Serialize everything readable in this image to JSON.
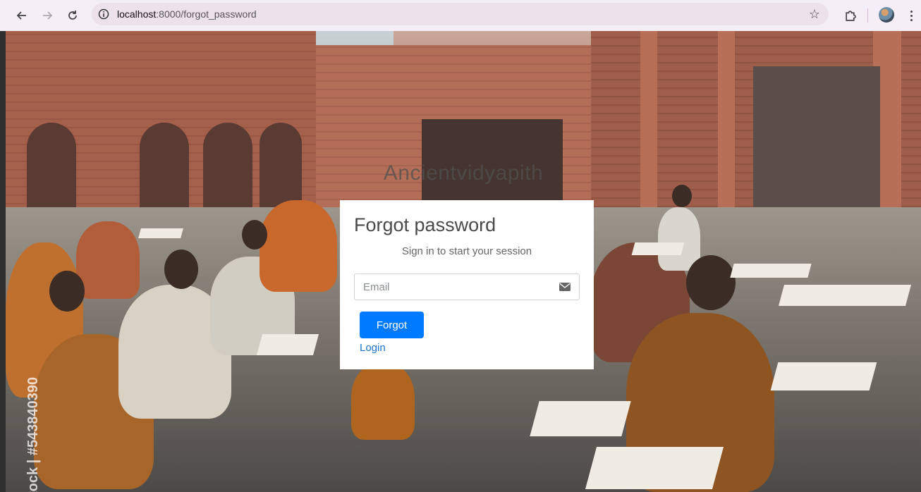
{
  "browser": {
    "url_host": "localhost",
    "url_rest": ":8000/forgot_password"
  },
  "page": {
    "brand": "Ancientvidyapith",
    "watermark": "tock | #543840390"
  },
  "card": {
    "title": "Forgot password",
    "message": "Sign in to start your session",
    "email_placeholder": "Email",
    "email_value": "",
    "submit_label": "Forgot",
    "login_link": "Login",
    "accent_color": "#007bff"
  },
  "icons": {
    "back": "arrow-left-icon",
    "forward": "arrow-right-icon",
    "reload": "reload-icon",
    "site_info": "site-info-icon",
    "bookmark": "star-icon",
    "extensions": "puzzle-icon",
    "profile": "avatar",
    "menu": "kebab-menu-icon",
    "email": "envelope-icon"
  }
}
